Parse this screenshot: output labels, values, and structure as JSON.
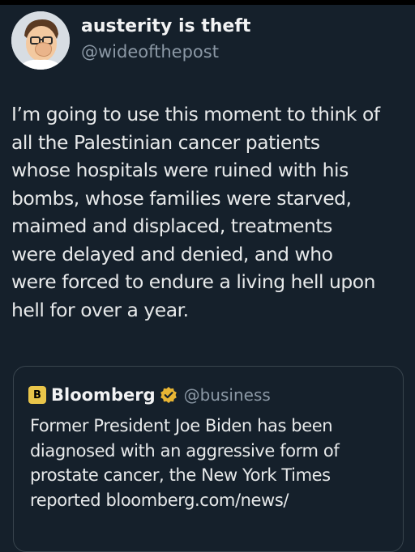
{
  "colors": {
    "background": "#15202b",
    "text": "#e7e9ea",
    "secondary_text": "#8b98a5",
    "border": "#38444d",
    "verified_gold": "#e8b534",
    "bloomberg_logo": "#e9c54a"
  },
  "post": {
    "author": {
      "display_name": "austerity is theft",
      "handle": "@wideofthepost",
      "avatar_icon": "cartoon-character-facepalm-avatar"
    },
    "text": "I’m going to use this moment to think of\nall the Palestinian cancer patients\nwhose hospitals were ruined with his\nbombs, whose families were starved,\nmaimed and displaced, treatments\nwere delayed and denied, and who\nwere forced to endure a living hell upon\nhell for over a year."
  },
  "quoted_post": {
    "logo_letter": "B",
    "display_name": "Bloomberg",
    "verified_icon": "gold-verified-badge-icon",
    "handle": "@business",
    "text": "Former President Joe Biden has been\ndiagnosed with an aggressive form of\nprostate cancer, the New York Times\nreported bloomberg.com/news/"
  }
}
